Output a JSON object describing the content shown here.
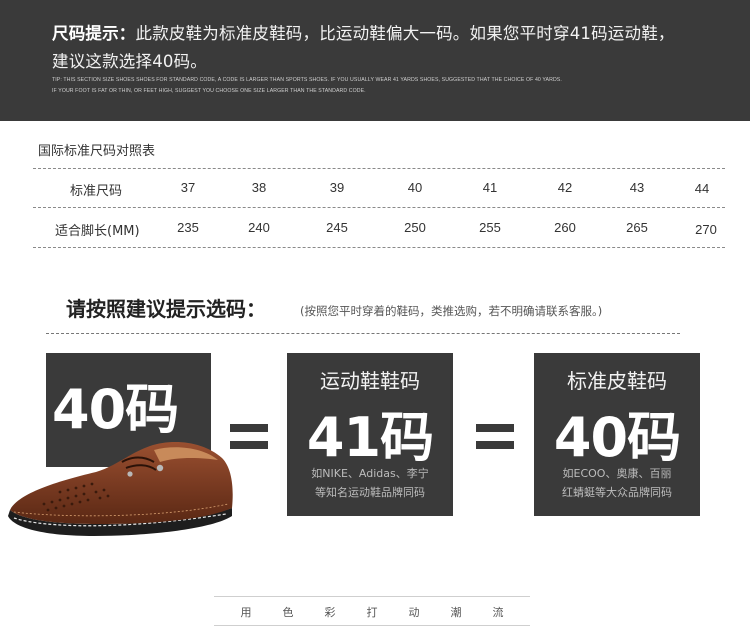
{
  "banner": {
    "title_bold": "尺码提示：",
    "title_rest": "此款皮鞋为标准皮鞋码，比运动鞋偏大一码。如果您平时穿41码运动鞋，",
    "line2": "建议这款选择40码。",
    "en_line1": "TIP: THIS SECTION SIZE SHOES SHOES FOR STANDARD CODE, A CODE IS LARGER THAN SPORTS SHOES. IF YOU USUALLY WEAR 41 YARDS SHOES, SUGGESTED THAT THE CHOICE OF 40 YARDS.",
    "en_line2": "IF YOUR FOOT IS FAT OR THIN, OR FEET HIGH, SUGGEST YOU CHOOSE ONE SIZE LARGER THAN THE STANDARD CODE."
  },
  "size_table": {
    "title": "国际标准尺码对照表",
    "rows": [
      {
        "label": "标准尺码",
        "values": [
          "37",
          "38",
          "39",
          "40",
          "41",
          "42",
          "43",
          "44"
        ]
      },
      {
        "label": "适合脚长(MM)",
        "values": [
          "235",
          "240",
          "245",
          "250",
          "255",
          "260",
          "265",
          "270"
        ]
      }
    ]
  },
  "advice": {
    "title": "请按照建议提示选码：",
    "note": "(按照您平时穿着的鞋码，类推选购，若不明确请联系客服。)"
  },
  "boxes": {
    "recommended": {
      "big": "40码"
    },
    "sports": {
      "sub": "运动鞋鞋码",
      "big": "41码",
      "note1": "如NIKE、Adidas、李宁",
      "note2": "等知名运动鞋品牌同码"
    },
    "leather": {
      "sub": "标准皮鞋码",
      "big": "40码",
      "note1": "如ECOO、奥康、百丽",
      "note2": "红蜻蜓等大众品牌同码"
    }
  },
  "footer": {
    "items": [
      "用",
      "色",
      "彩",
      "打",
      "动",
      "潮",
      "流"
    ]
  },
  "colors": {
    "dark_panel": "#3a3a3a",
    "shoe_leather": "#7a3b22",
    "shoe_sole": "#1e1e1e"
  }
}
